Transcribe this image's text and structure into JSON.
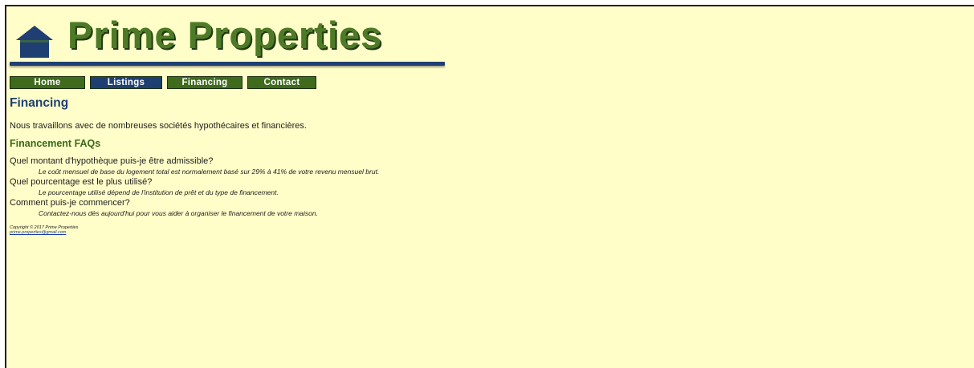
{
  "logo": {
    "title": "Prime Properties"
  },
  "nav": [
    {
      "label": "Home",
      "id": "home",
      "width": 92,
      "tone": "green"
    },
    {
      "label": "Listings",
      "id": "listings",
      "width": 88,
      "tone": "blue"
    },
    {
      "label": "Financing",
      "id": "financing",
      "width": 92,
      "tone": "green"
    },
    {
      "label": "Contact",
      "id": "contact",
      "width": 84,
      "tone": "green"
    }
  ],
  "main": {
    "title": "Financing",
    "intro": "Nous travaillons avec de nombreuses sociétés hypothécaires et financières.",
    "faq_title": "Financement FAQs",
    "faqs": [
      {
        "q": "Quel montant d'hypothèque puis-je être admissible?",
        "a": "Le coût mensuel de base du logement total est normalement basé sur 29% à 41% de votre revenu mensuel brut."
      },
      {
        "q": "Quel pourcentage est le plus utilisé?",
        "a": "Le pourcentage utilisé dépend de l'institution de prêt et du type de financement."
      },
      {
        "q": "Comment puis-je commencer?",
        "a": "Contactez-nous dès aujourd'hui pour vous aider à organiser le financement de votre maison."
      }
    ]
  },
  "footer": {
    "copyright": "Copyright © 2017 Prime Properties",
    "email": "prime.properties@gmail.com"
  },
  "colors": {
    "background": "#fffdc8",
    "brand_green": "#3f6b1c",
    "brand_blue": "#1f3f73"
  }
}
